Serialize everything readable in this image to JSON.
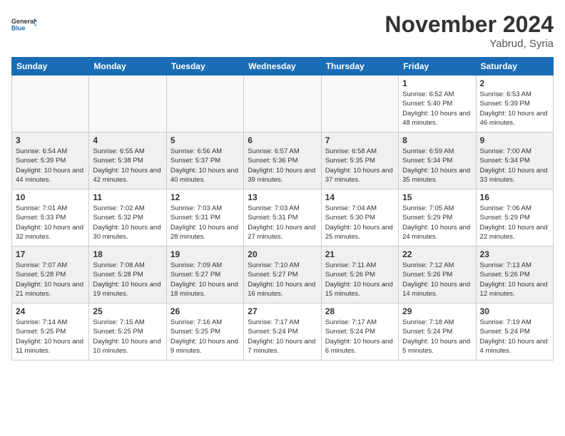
{
  "header": {
    "logo_general": "General",
    "logo_blue": "Blue",
    "month_title": "November 2024",
    "location": "Yabrud, Syria"
  },
  "days_of_week": [
    "Sunday",
    "Monday",
    "Tuesday",
    "Wednesday",
    "Thursday",
    "Friday",
    "Saturday"
  ],
  "weeks": [
    [
      {
        "day": "",
        "info": "",
        "empty": true
      },
      {
        "day": "",
        "info": "",
        "empty": true
      },
      {
        "day": "",
        "info": "",
        "empty": true
      },
      {
        "day": "",
        "info": "",
        "empty": true
      },
      {
        "day": "",
        "info": "",
        "empty": true
      },
      {
        "day": "1",
        "info": "Sunrise: 6:52 AM\nSunset: 5:40 PM\nDaylight: 10 hours and 48 minutes."
      },
      {
        "day": "2",
        "info": "Sunrise: 6:53 AM\nSunset: 5:39 PM\nDaylight: 10 hours and 46 minutes."
      }
    ],
    [
      {
        "day": "3",
        "info": "Sunrise: 6:54 AM\nSunset: 5:39 PM\nDaylight: 10 hours and 44 minutes."
      },
      {
        "day": "4",
        "info": "Sunrise: 6:55 AM\nSunset: 5:38 PM\nDaylight: 10 hours and 42 minutes."
      },
      {
        "day": "5",
        "info": "Sunrise: 6:56 AM\nSunset: 5:37 PM\nDaylight: 10 hours and 40 minutes."
      },
      {
        "day": "6",
        "info": "Sunrise: 6:57 AM\nSunset: 5:36 PM\nDaylight: 10 hours and 39 minutes."
      },
      {
        "day": "7",
        "info": "Sunrise: 6:58 AM\nSunset: 5:35 PM\nDaylight: 10 hours and 37 minutes."
      },
      {
        "day": "8",
        "info": "Sunrise: 6:59 AM\nSunset: 5:34 PM\nDaylight: 10 hours and 35 minutes."
      },
      {
        "day": "9",
        "info": "Sunrise: 7:00 AM\nSunset: 5:34 PM\nDaylight: 10 hours and 33 minutes."
      }
    ],
    [
      {
        "day": "10",
        "info": "Sunrise: 7:01 AM\nSunset: 5:33 PM\nDaylight: 10 hours and 32 minutes."
      },
      {
        "day": "11",
        "info": "Sunrise: 7:02 AM\nSunset: 5:32 PM\nDaylight: 10 hours and 30 minutes."
      },
      {
        "day": "12",
        "info": "Sunrise: 7:03 AM\nSunset: 5:31 PM\nDaylight: 10 hours and 28 minutes."
      },
      {
        "day": "13",
        "info": "Sunrise: 7:03 AM\nSunset: 5:31 PM\nDaylight: 10 hours and 27 minutes."
      },
      {
        "day": "14",
        "info": "Sunrise: 7:04 AM\nSunset: 5:30 PM\nDaylight: 10 hours and 25 minutes."
      },
      {
        "day": "15",
        "info": "Sunrise: 7:05 AM\nSunset: 5:29 PM\nDaylight: 10 hours and 24 minutes."
      },
      {
        "day": "16",
        "info": "Sunrise: 7:06 AM\nSunset: 5:29 PM\nDaylight: 10 hours and 22 minutes."
      }
    ],
    [
      {
        "day": "17",
        "info": "Sunrise: 7:07 AM\nSunset: 5:28 PM\nDaylight: 10 hours and 21 minutes."
      },
      {
        "day": "18",
        "info": "Sunrise: 7:08 AM\nSunset: 5:28 PM\nDaylight: 10 hours and 19 minutes."
      },
      {
        "day": "19",
        "info": "Sunrise: 7:09 AM\nSunset: 5:27 PM\nDaylight: 10 hours and 18 minutes."
      },
      {
        "day": "20",
        "info": "Sunrise: 7:10 AM\nSunset: 5:27 PM\nDaylight: 10 hours and 16 minutes."
      },
      {
        "day": "21",
        "info": "Sunrise: 7:11 AM\nSunset: 5:26 PM\nDaylight: 10 hours and 15 minutes."
      },
      {
        "day": "22",
        "info": "Sunrise: 7:12 AM\nSunset: 5:26 PM\nDaylight: 10 hours and 14 minutes."
      },
      {
        "day": "23",
        "info": "Sunrise: 7:13 AM\nSunset: 5:26 PM\nDaylight: 10 hours and 12 minutes."
      }
    ],
    [
      {
        "day": "24",
        "info": "Sunrise: 7:14 AM\nSunset: 5:25 PM\nDaylight: 10 hours and 11 minutes."
      },
      {
        "day": "25",
        "info": "Sunrise: 7:15 AM\nSunset: 5:25 PM\nDaylight: 10 hours and 10 minutes."
      },
      {
        "day": "26",
        "info": "Sunrise: 7:16 AM\nSunset: 5:25 PM\nDaylight: 10 hours and 9 minutes."
      },
      {
        "day": "27",
        "info": "Sunrise: 7:17 AM\nSunset: 5:24 PM\nDaylight: 10 hours and 7 minutes."
      },
      {
        "day": "28",
        "info": "Sunrise: 7:17 AM\nSunset: 5:24 PM\nDaylight: 10 hours and 6 minutes."
      },
      {
        "day": "29",
        "info": "Sunrise: 7:18 AM\nSunset: 5:24 PM\nDaylight: 10 hours and 5 minutes."
      },
      {
        "day": "30",
        "info": "Sunrise: 7:19 AM\nSunset: 5:24 PM\nDaylight: 10 hours and 4 minutes."
      }
    ]
  ]
}
